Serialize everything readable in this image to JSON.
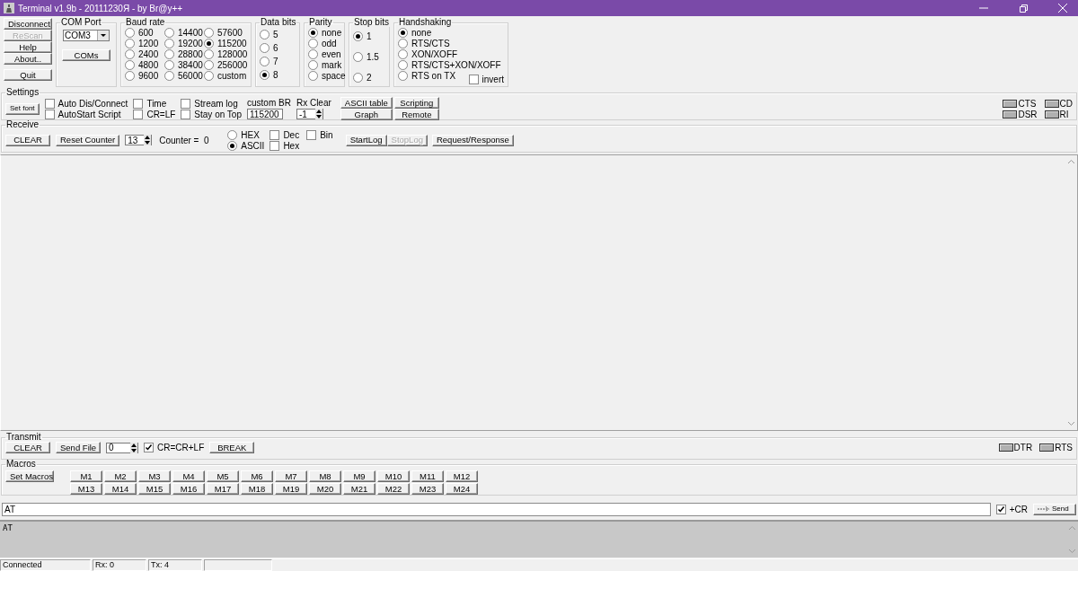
{
  "window": {
    "title": "Terminal v1.9b - 20111230Я - by Br@y++"
  },
  "side_buttons": [
    {
      "label": "Disconnect",
      "disabled": false
    },
    {
      "label": "ReScan",
      "disabled": true
    },
    {
      "label": "Help",
      "disabled": false
    },
    {
      "label": "About..",
      "disabled": false
    },
    {
      "label": "Quit",
      "disabled": false
    }
  ],
  "com_port": {
    "title": "COM Port",
    "value": "COM3",
    "button": "COMs"
  },
  "radio_groups": [
    {
      "title": "Baud rate",
      "kind": "baud",
      "options": [
        {
          "label": "600",
          "selected": false
        },
        {
          "label": "1200",
          "selected": false
        },
        {
          "label": "2400",
          "selected": false
        },
        {
          "label": "4800",
          "selected": false
        },
        {
          "label": "9600",
          "selected": false
        },
        {
          "label": "14400",
          "selected": false
        },
        {
          "label": "19200",
          "selected": false
        },
        {
          "label": "28800",
          "selected": false
        },
        {
          "label": "38400",
          "selected": false
        },
        {
          "label": "56000",
          "selected": false
        },
        {
          "label": "57600",
          "selected": false
        },
        {
          "label": "115200",
          "selected": true
        },
        {
          "label": "128000",
          "selected": false
        },
        {
          "label": "256000",
          "selected": false
        },
        {
          "label": "custom",
          "selected": false
        }
      ]
    },
    {
      "title": "Data bits",
      "kind": "data",
      "options": [
        {
          "label": "5",
          "selected": false
        },
        {
          "label": "6",
          "selected": false
        },
        {
          "label": "7",
          "selected": false
        },
        {
          "label": "8",
          "selected": true
        }
      ]
    },
    {
      "title": "Parity",
      "kind": "parity",
      "options": [
        {
          "label": "none",
          "selected": true
        },
        {
          "label": "odd",
          "selected": false
        },
        {
          "label": "even",
          "selected": false
        },
        {
          "label": "mark",
          "selected": false
        },
        {
          "label": "space",
          "selected": false
        }
      ]
    },
    {
      "title": "Stop bits",
      "kind": "stop",
      "options": [
        {
          "label": "1",
          "selected": true
        },
        {
          "label": "1.5",
          "selected": false
        },
        {
          "label": "2",
          "selected": false
        }
      ]
    },
    {
      "title": "Handshaking",
      "kind": "handshake",
      "options": [
        {
          "label": "none",
          "selected": true
        },
        {
          "label": "RTS/CTS",
          "selected": false
        },
        {
          "label": "XON/XOFF",
          "selected": false
        },
        {
          "label": "RTS/CTS+XON/XOFF",
          "selected": false
        },
        {
          "label": "RTS on TX",
          "selected": false
        }
      ],
      "invert": {
        "label": "invert",
        "checked": false
      }
    }
  ],
  "settings": {
    "title": "Settings",
    "set_font": "Set font",
    "checkboxes": [
      {
        "label": "Auto Dis/Connect",
        "checked": false
      },
      {
        "label": "AutoStart Script",
        "checked": false
      },
      {
        "label": "Time",
        "checked": false
      },
      {
        "label": "CR=LF",
        "checked": false
      },
      {
        "label": "Stream log",
        "checked": false
      },
      {
        "label": "Stay on Top",
        "checked": false
      }
    ],
    "custom_br": {
      "label": "custom BR",
      "value": "115200"
    },
    "rx_clear": {
      "label": "Rx Clear",
      "value": "-1"
    },
    "buttons": [
      "ASCII table",
      "Graph",
      "Scripting",
      "Remote"
    ],
    "indicators": [
      {
        "label": "CTS",
        "on": false
      },
      {
        "label": "CD",
        "on": false
      },
      {
        "label": "DSR",
        "on": false
      },
      {
        "label": "RI",
        "on": false
      }
    ]
  },
  "receive": {
    "title": "Receive",
    "clear": "CLEAR",
    "reset_counter": "Reset Counter",
    "spin_value": "13",
    "counter": "Counter =  0",
    "modes": [
      {
        "label": "HEX",
        "selected": false
      },
      {
        "label": "ASCII",
        "selected": true
      }
    ],
    "checkboxes": [
      {
        "label": "Dec",
        "checked": false
      },
      {
        "label": "Hex",
        "checked": false
      },
      {
        "label": "Bin",
        "checked": false
      }
    ],
    "buttons": [
      {
        "label": "StartLog",
        "disabled": false
      },
      {
        "label": "StopLog",
        "disabled": true
      },
      {
        "label": "Request/Response",
        "disabled": false
      }
    ]
  },
  "transmit": {
    "title": "Transmit",
    "clear": "CLEAR",
    "send_file": "Send File",
    "spin_value": "0",
    "cr_lf": {
      "label": "CR=CR+LF",
      "checked": true
    },
    "break": "BREAK",
    "indicators": [
      {
        "label": "DTR",
        "on": false
      },
      {
        "label": "RTS",
        "on": false
      }
    ]
  },
  "macros": {
    "title": "Macros",
    "set_macros": "Set Macros",
    "buttons": [
      "M1",
      "M2",
      "M3",
      "M4",
      "M5",
      "M6",
      "M7",
      "M8",
      "M9",
      "M10",
      "M11",
      "M12",
      "M13",
      "M14",
      "M15",
      "M16",
      "M17",
      "M18",
      "M19",
      "M20",
      "M21",
      "M22",
      "M23",
      "M24"
    ]
  },
  "send_line": {
    "value": "AT",
    "plus_cr": {
      "label": "+CR",
      "checked": true
    },
    "send": "Send"
  },
  "output": {
    "text": "AT"
  },
  "status_bar": [
    "Connected",
    "Rx: 0",
    "Tx: 4"
  ]
}
